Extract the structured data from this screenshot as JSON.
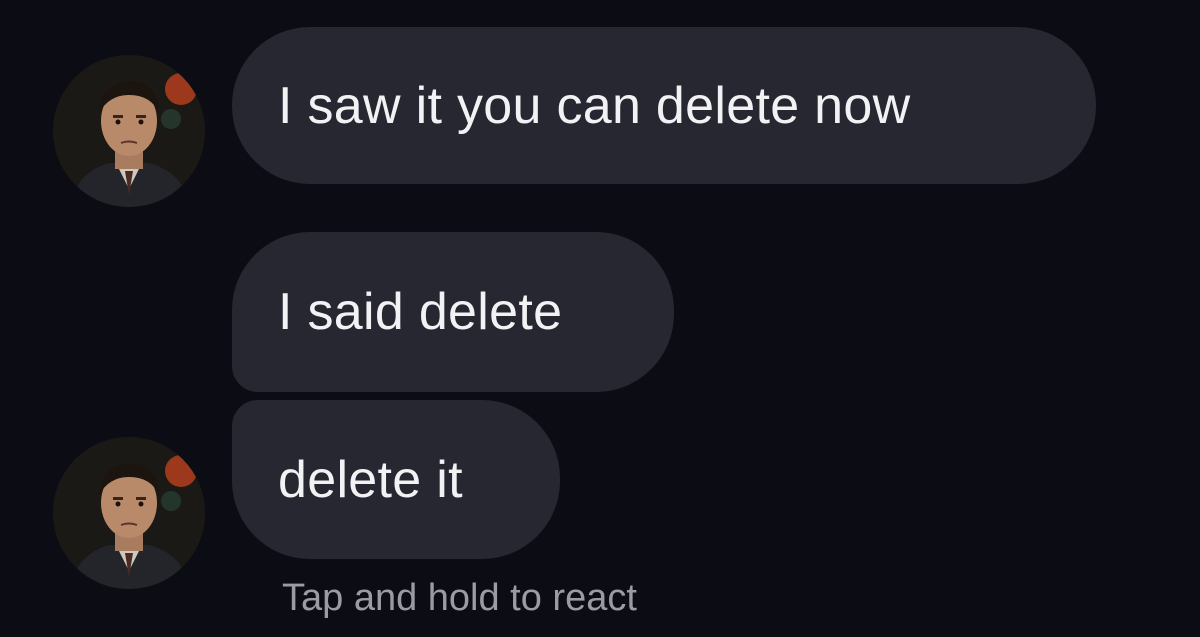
{
  "conversation": {
    "messages": [
      {
        "sender_avatar": "contact-avatar",
        "text": "I saw it you can delete now"
      },
      {
        "text": "I said delete"
      },
      {
        "sender_avatar": "contact-avatar",
        "text": "delete it"
      }
    ],
    "reaction_hint": "Tap and hold to react"
  },
  "colors": {
    "background": "#0c0d14",
    "bubble": "#262730",
    "bubble_text": "#f2f2f5",
    "hint_text": "#9a9ba3"
  }
}
